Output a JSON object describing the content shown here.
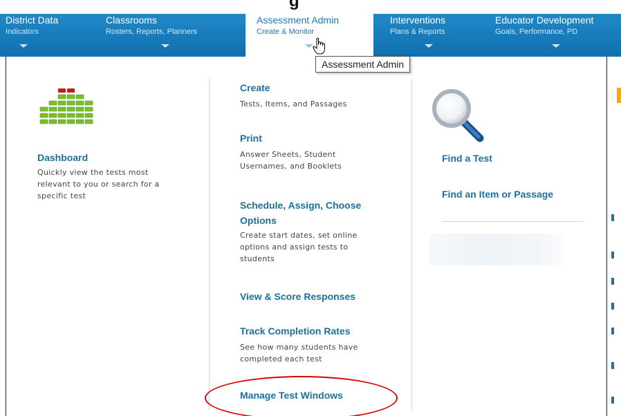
{
  "top_partial_text": "g",
  "nav": [
    {
      "title": "District Data",
      "subtitle": "Indicators"
    },
    {
      "title": "Classrooms",
      "subtitle": "Rosters, Reports, Planners"
    },
    {
      "title": "Assessment Admin",
      "subtitle": "Create & Monitor"
    },
    {
      "title": "Interventions",
      "subtitle": "Plans & Reports"
    },
    {
      "title": "Educator Development",
      "subtitle": "Goals, Performance, PD"
    }
  ],
  "tooltip": "Assessment Admin",
  "dashboard": {
    "icon": "bar-grid-icon",
    "label": "Dashboard",
    "desc_lines": [
      "Quickly view the tests most",
      "relevant to you or search for a",
      "specific test"
    ]
  },
  "menu": {
    "create": {
      "label": "Create",
      "desc_lines": [
        "Tests, Items, and Passages"
      ]
    },
    "print": {
      "label": "Print",
      "desc_lines": [
        "Answer Sheets, Student",
        "Usernames, and Booklets"
      ]
    },
    "schedule": {
      "label_lines": [
        "Schedule, Assign, Choose",
        "Options"
      ],
      "desc_lines": [
        "Create start dates, set online",
        "options and assign tests to",
        "students"
      ]
    },
    "view_score": {
      "label": "View & Score Responses"
    },
    "track": {
      "label": "Track Completion Rates",
      "desc_lines": [
        "See how many students have",
        "completed each test"
      ]
    },
    "manage": {
      "label": "Manage Test Windows"
    }
  },
  "find": {
    "icon": "magnifier-icon",
    "find_test": "Find a Test",
    "find_item": "Find an Item or Passage"
  },
  "colors": {
    "nav_bg": "#1a7ec0",
    "link": "#1d6f9c",
    "highlight_circle": "#d60000"
  }
}
